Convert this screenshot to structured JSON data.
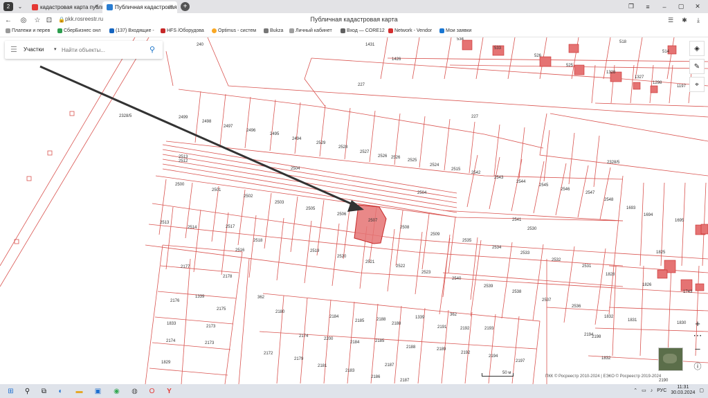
{
  "browser": {
    "tab_count": "2",
    "tabs": [
      {
        "label": "кадастровая карта публи",
        "favicon_color": "#e53935"
      },
      {
        "label": "Публичная кадастровая",
        "favicon_color": "#2a7dd1"
      }
    ],
    "url": "pkk.rosreestr.ru",
    "page_title": "Публичная кадастровая карта"
  },
  "bookmarks": [
    {
      "label": "Платежи и перев",
      "color": "#999999"
    },
    {
      "label": "СберБизнес онл",
      "color": "#2e9e4f"
    },
    {
      "label": "(137) Входящие -",
      "color": "#1565c0"
    },
    {
      "label": "HFS /Оборудова",
      "color": "#c62828"
    },
    {
      "label": "Optimus - систем",
      "color": "#f9a825"
    },
    {
      "label": "Bukza",
      "color": "#777777"
    },
    {
      "label": "Личный кабинет",
      "color": "#9e9e9e"
    },
    {
      "label": "Вход — CORE12",
      "color": "#616161"
    },
    {
      "label": "Network - Vendor",
      "color": "#d32f2f"
    },
    {
      "label": "Мои заявки",
      "color": "#1976d2"
    }
  ],
  "search": {
    "type_label": "Участки",
    "placeholder": "Найти объекты..."
  },
  "map": {
    "parcel_labels": [
      "240",
      "1431",
      "1426",
      "534",
      "533",
      "526",
      "518",
      "514",
      "525",
      "1328",
      "1327",
      "1298",
      "1197",
      "227",
      "227",
      "2328/5",
      "2328/5",
      "2499",
      "2498",
      "2497",
      "2496",
      "2495",
      "2494",
      "2529",
      "2528",
      "2527",
      "2526",
      "2526",
      "2525",
      "2524",
      "2515",
      "2542",
      "2543",
      "2544",
      "2545",
      "2546",
      "2547",
      "2548",
      "2513",
      "2512",
      "2504",
      "2504",
      "2500",
      "2501",
      "2502",
      "2503",
      "2505",
      "2506",
      "2507",
      "2508",
      "2509",
      "2535",
      "2534",
      "2533",
      "2532",
      "2531",
      "2530",
      "2541",
      "1693",
      "1694",
      "1695",
      "2513",
      "2514",
      "2517",
      "2518",
      "2519",
      "2520",
      "2521",
      "2522",
      "2523",
      "2540",
      "2539",
      "2538",
      "2537",
      "2536",
      "1825",
      "1828",
      "1826",
      "1743",
      "2516",
      "2177",
      "2178",
      "2176",
      "1339",
      "2175",
      "362",
      "2180",
      "2184",
      "2185",
      "2188",
      "2188",
      "1339",
      "362",
      "2191",
      "2192",
      "2193",
      "2194",
      "1832",
      "1831",
      "1830",
      "1833",
      "2173",
      "2174",
      "2173",
      "2174",
      "2200",
      "2184",
      "2185",
      "2188",
      "2189",
      "2192",
      "2194",
      "2197",
      "2198",
      "1832",
      "1829",
      "2172",
      "2179",
      "2181",
      "2183",
      "2186",
      "2187",
      "2187",
      "2190",
      "1834"
    ],
    "scale_label": "50 м",
    "copyright": "ПКК © Росреестр 2010-2024 | ЕЭКО © Росреестр 2019-2024",
    "highlight_color": "#e57373",
    "line_color": "#d9534f"
  },
  "taskbar": {
    "lang": "РУС",
    "time": "11:31",
    "date": "30.03.2024"
  }
}
